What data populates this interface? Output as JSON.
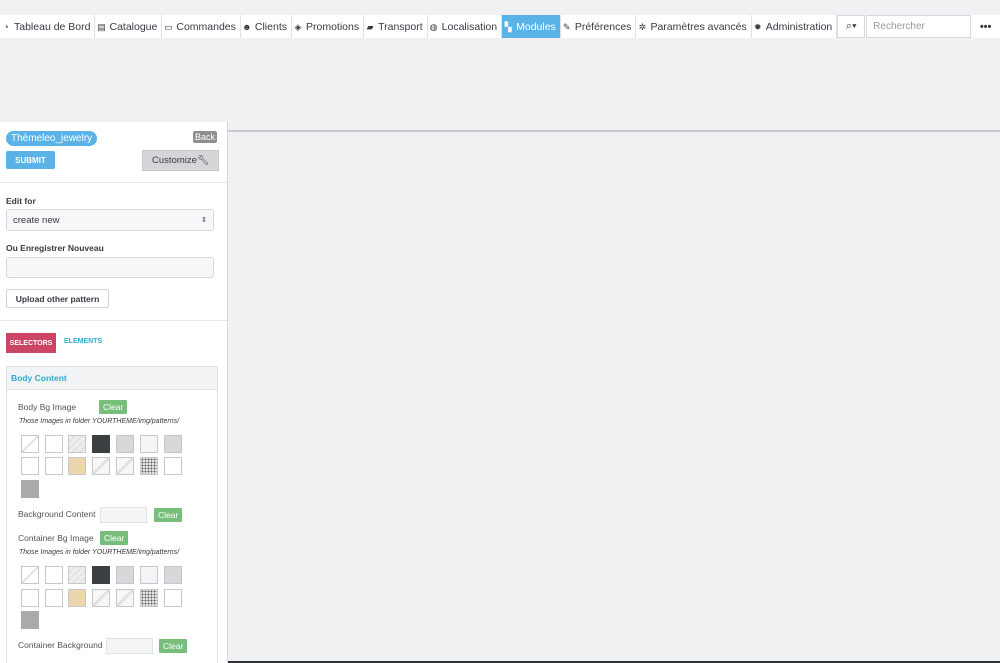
{
  "nav": {
    "items": [
      {
        "icon": "dashboard-icon",
        "glyph": "◔",
        "label": "Tableau de Bord"
      },
      {
        "icon": "book-icon",
        "glyph": "▤",
        "label": "Catalogue"
      },
      {
        "icon": "credit-card-icon",
        "glyph": "▭",
        "label": "Commandes"
      },
      {
        "icon": "users-icon",
        "glyph": "☻",
        "label": "Clients"
      },
      {
        "icon": "tags-icon",
        "glyph": "◈",
        "label": "Promotions"
      },
      {
        "icon": "truck-icon",
        "glyph": "▰",
        "label": "Transport"
      },
      {
        "icon": "globe-icon",
        "glyph": "◍",
        "label": "Localisation"
      },
      {
        "icon": "puzzle-icon",
        "glyph": "▚",
        "label": "Modules"
      },
      {
        "icon": "wrench-icon",
        "glyph": "✎",
        "label": "Préférences"
      },
      {
        "icon": "cogs-icon",
        "glyph": "✲",
        "label": "Paramètres avancés"
      },
      {
        "icon": "cog-icon",
        "glyph": "✹",
        "label": "Administration"
      }
    ],
    "active": "Modules",
    "search_placeholder": "Rechercher",
    "more": "•••"
  },
  "panel": {
    "theme_name": "Thèmeleo_jewelry",
    "back": "Back",
    "submit": "SUBMIT",
    "customize": "Customize",
    "edit_for_label": "Edit for",
    "edit_for_value": "create new",
    "save_new_label": "Ou Enregistrer Nouveau",
    "upload_label": "Upload other pattern",
    "tab_selectors": "SELECTORS",
    "tab_elements": "ELEMENTS",
    "section_title": "Body Content",
    "body_bg_label": "Body Bg Image",
    "clear": "Clear",
    "patterns_note": "Those Images in folder YOURTHEME/img/patterns/",
    "bg_content_label": "Background Content",
    "container_bg_label": "Container Bg Image",
    "container_background_label": "Container Background"
  },
  "colors": {
    "active_nav": "#5ab3e6",
    "selectors_tab": "#cb4565",
    "clear_button": "#78be7b"
  }
}
